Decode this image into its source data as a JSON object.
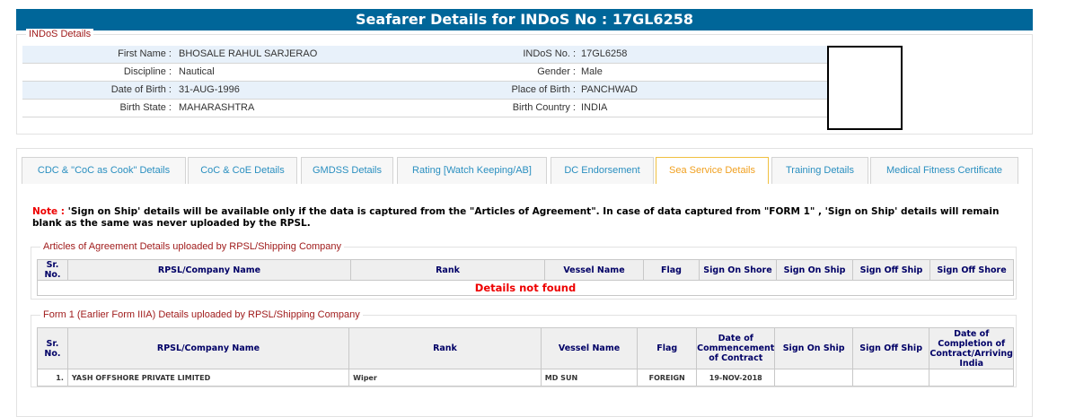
{
  "title": "Seafarer Details for INDoS No : 17GL6258",
  "indos": {
    "legend": "INDoS Details",
    "rows": [
      {
        "l1": "First Name :",
        "v1": "BHOSALE RAHUL SARJERAO",
        "l2": "INDoS No. :",
        "v2": "17GL6258"
      },
      {
        "l1": "Discipline :",
        "v1": "Nautical",
        "l2": "Gender :",
        "v2": "Male"
      },
      {
        "l1": "Date of Birth :",
        "v1": "31-AUG-1996",
        "l2": "Place of Birth :",
        "v2": "PANCHWAD"
      },
      {
        "l1": "Birth State :",
        "v1": "MAHARASHTRA",
        "l2": "Birth Country :",
        "v2": "INDIA"
      }
    ]
  },
  "tabs": [
    "CDC & \"CoC as Cook\" Details",
    "CoC & CoE Details",
    "GMDSS Details",
    "Rating [Watch Keeping/AB]",
    "DC Endorsement",
    "Sea Service Details",
    "Training Details",
    "Medical Fitness Certificate"
  ],
  "note": {
    "label": "Note :",
    "text": " 'Sign on Ship' details will be available only if the data is captured from the \"Articles of Agreement\". In case of data captured from \"FORM 1\" , 'Sign on Ship' details will remain blank as the same was never uploaded by the RPSL."
  },
  "articles": {
    "legend": "Articles of Agreement Details uploaded by RPSL/Shipping Company",
    "headers": [
      "Sr. No.",
      "RPSL/Company Name",
      "Rank",
      "Vessel Name",
      "Flag",
      "Sign On Shore",
      "Sign On Ship",
      "Sign Off Ship",
      "Sign Off Shore"
    ],
    "empty": "Details not found"
  },
  "form1": {
    "legend": "Form 1 (Earlier Form IIIA) Details uploaded by RPSL/Shipping Company",
    "headers": [
      "Sr. No.",
      "RPSL/Company Name",
      "Rank",
      "Vessel Name",
      "Flag",
      "Date of Commencement of Contract",
      "Sign On Ship",
      "Sign Off Ship",
      "Date of Completion of Contract/Arriving India"
    ],
    "rows": [
      [
        "1.",
        "YASH OFFSHORE PRIVATE LIMITED",
        "Wiper",
        "MD SUN",
        "FOREIGN",
        "19-NOV-2018",
        "",
        "",
        ""
      ]
    ]
  }
}
